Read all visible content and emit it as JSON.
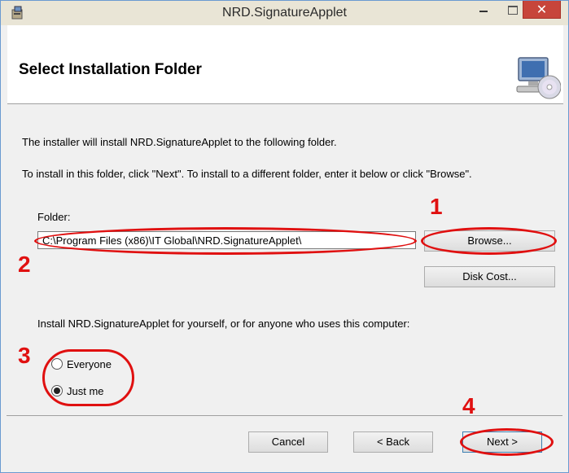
{
  "window": {
    "title": "NRD.SignatureApplet"
  },
  "header": {
    "title": "Select Installation Folder"
  },
  "intro": {
    "line1": "The installer will install NRD.SignatureApplet to the following folder.",
    "line2": "To install in this folder, click \"Next\". To install to a different folder, enter it below or click \"Browse\"."
  },
  "folder": {
    "label": "Folder:",
    "value": "C:\\Program Files (x86)\\IT Global\\NRD.SignatureApplet\\"
  },
  "buttons": {
    "browse": "Browse...",
    "disk_cost": "Disk Cost...",
    "cancel": "Cancel",
    "back": "< Back",
    "next": "Next >"
  },
  "install_for": {
    "prompt": "Install NRD.SignatureApplet for yourself, or for anyone who uses this computer:",
    "options": [
      {
        "label": "Everyone",
        "selected": false
      },
      {
        "label": "Just me",
        "selected": true
      }
    ]
  },
  "annotations": [
    "1",
    "2",
    "3",
    "4"
  ],
  "colors": {
    "annotation": "#e01010",
    "close_button": "#c7453b"
  },
  "icons": {
    "app": "installer-icon",
    "header": "computer-cd-icon"
  }
}
